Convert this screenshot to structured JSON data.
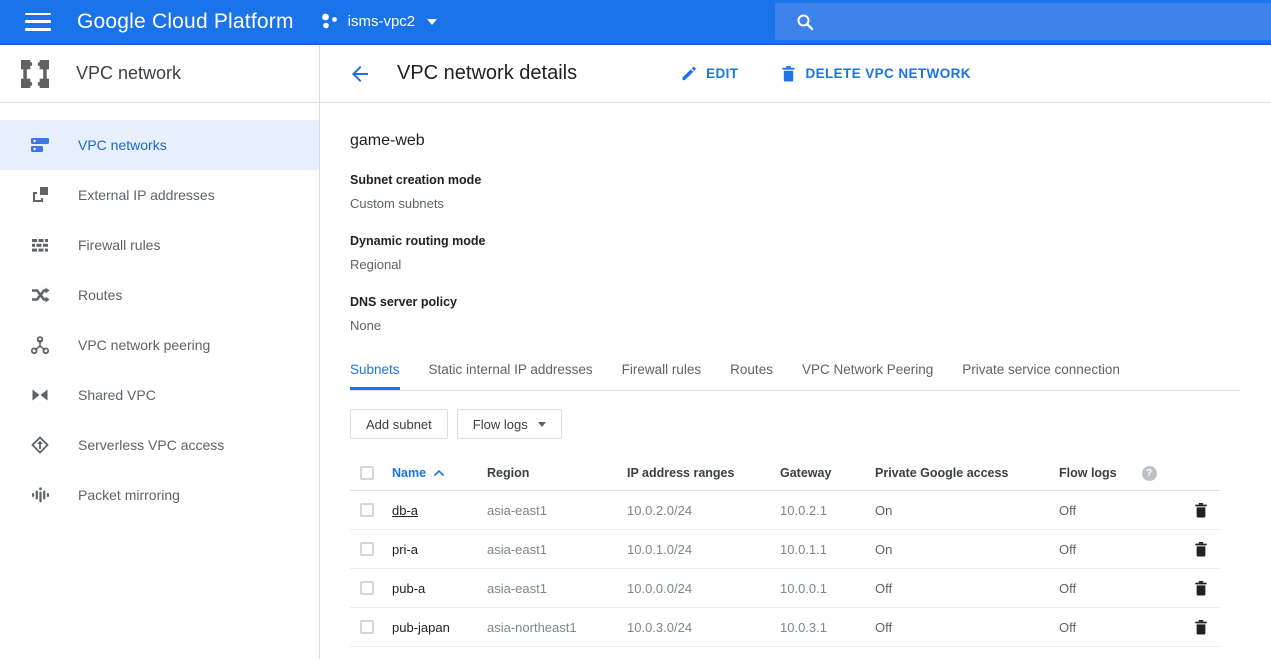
{
  "colors": {
    "accent": "#1a73e8",
    "topbar": "#1a73e8",
    "topbar_border": "#1765cc",
    "search_bg": "#3d83eb",
    "active_item_bg": "#e8f0fe",
    "active_item_text": "#1967d2"
  },
  "topbar": {
    "brand": "Google Cloud Platform",
    "project": "isms-vpc2",
    "search_icon": "search-icon"
  },
  "sidebar": {
    "title": "VPC network",
    "items": [
      {
        "label": "VPC networks",
        "icon": "vpc-networks-icon",
        "active": true
      },
      {
        "label": "External IP addresses",
        "icon": "external-ip-icon",
        "active": false
      },
      {
        "label": "Firewall rules",
        "icon": "firewall-icon",
        "active": false
      },
      {
        "label": "Routes",
        "icon": "routes-icon",
        "active": false
      },
      {
        "label": "VPC network peering",
        "icon": "peering-icon",
        "active": false
      },
      {
        "label": "Shared VPC",
        "icon": "shared-vpc-icon",
        "active": false
      },
      {
        "label": "Serverless VPC access",
        "icon": "serverless-icon",
        "active": false
      },
      {
        "label": "Packet mirroring",
        "icon": "packet-mirroring-icon",
        "active": false
      }
    ]
  },
  "main": {
    "title": "VPC network details",
    "actions": {
      "edit": "EDIT",
      "delete": "DELETE VPC NETWORK"
    },
    "network_name": "game-web",
    "fields": [
      {
        "label": "Subnet creation mode",
        "value": "Custom subnets"
      },
      {
        "label": "Dynamic routing mode",
        "value": "Regional"
      },
      {
        "label": "DNS server policy",
        "value": "None"
      }
    ],
    "tabs": [
      {
        "label": "Subnets",
        "active": true
      },
      {
        "label": "Static internal IP addresses",
        "active": false
      },
      {
        "label": "Firewall rules",
        "active": false
      },
      {
        "label": "Routes",
        "active": false
      },
      {
        "label": "VPC Network Peering",
        "active": false
      },
      {
        "label": "Private service connection",
        "active": false
      }
    ],
    "toolbar": {
      "add_subnet": "Add subnet",
      "flow_logs": "Flow logs"
    },
    "table": {
      "columns": [
        "Name",
        "Region",
        "IP address ranges",
        "Gateway",
        "Private Google access",
        "Flow logs"
      ],
      "sort": {
        "column": "Name",
        "direction": "asc"
      },
      "help_glyph": "?",
      "rows": [
        {
          "name": "db-a",
          "region": "asia-east1",
          "ip": "10.0.2.0/24",
          "gateway": "10.0.2.1",
          "private_google_access": "On",
          "flow_logs": "Off"
        },
        {
          "name": "pri-a",
          "region": "asia-east1",
          "ip": "10.0.1.0/24",
          "gateway": "10.0.1.1",
          "private_google_access": "On",
          "flow_logs": "Off"
        },
        {
          "name": "pub-a",
          "region": "asia-east1",
          "ip": "10.0.0.0/24",
          "gateway": "10.0.0.1",
          "private_google_access": "Off",
          "flow_logs": "Off"
        },
        {
          "name": "pub-japan",
          "region": "asia-northeast1",
          "ip": "10.0.3.0/24",
          "gateway": "10.0.3.1",
          "private_google_access": "Off",
          "flow_logs": "Off"
        }
      ]
    }
  }
}
